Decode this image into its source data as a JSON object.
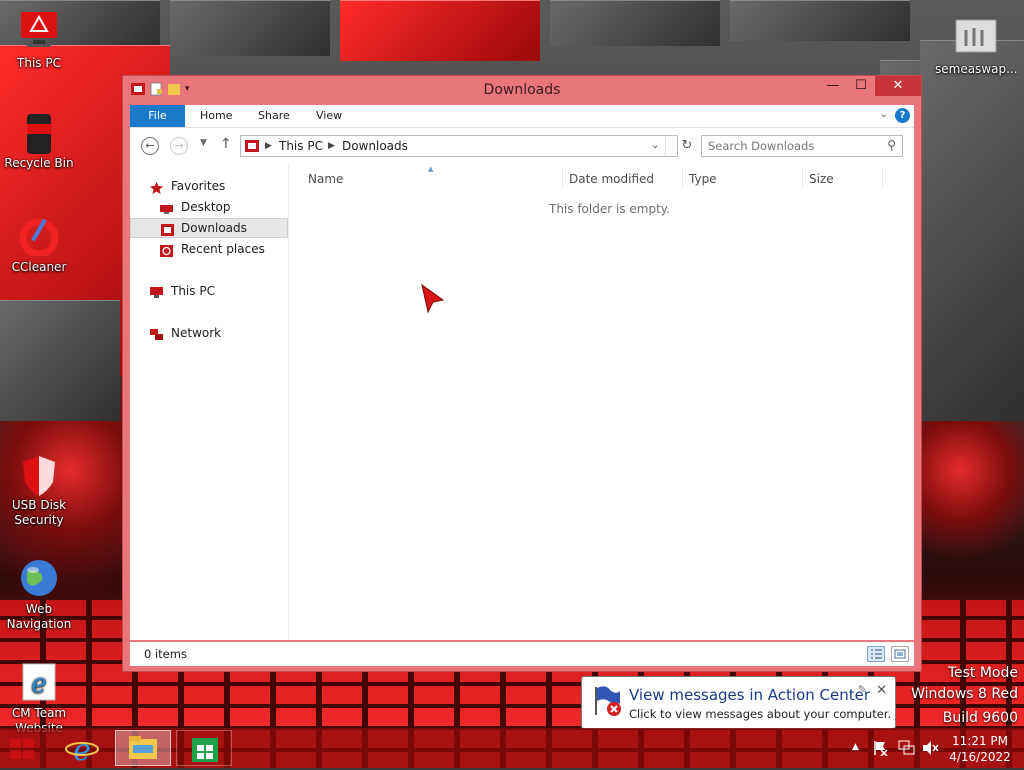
{
  "desktop": {
    "icons": [
      {
        "label": "This PC"
      },
      {
        "label": "Recycle Bin"
      },
      {
        "label": "CCleaner"
      },
      {
        "label": "USB Disk\nSecurity"
      },
      {
        "label": "Web\nNavigation"
      },
      {
        "label": "CM Team\nWebsite"
      },
      {
        "label": "semeaswap..."
      }
    ],
    "watermark": {
      "line1": "Test Mode",
      "line2": "Windows 8 Red",
      "line3": "Build 9600"
    }
  },
  "window": {
    "title": "Downloads",
    "controls": {
      "minimize": "—",
      "maximize": "☐",
      "close": "✕"
    },
    "ribbon": {
      "file": "File",
      "home": "Home",
      "share": "Share",
      "view": "View"
    },
    "address": {
      "seg1": "This PC",
      "seg2": "Downloads"
    },
    "search": {
      "placeholder": "Search Downloads"
    },
    "nav": {
      "favorites": "Favorites",
      "desktop": "Desktop",
      "downloads": "Downloads",
      "recent": "Recent places",
      "thispc": "This PC",
      "network": "Network"
    },
    "columns": {
      "name": "Name",
      "date": "Date modified",
      "type": "Type",
      "size": "Size"
    },
    "empty_text": "This folder is empty.",
    "status": {
      "count": "0 items"
    }
  },
  "notification": {
    "title": "View messages in Action Center",
    "body": "Click to view messages about your computer."
  },
  "tray": {
    "time": "11:21 PM",
    "date": "4/16/2022"
  },
  "colors": {
    "accent": "#1979ca",
    "window_frame": "#e8767a",
    "close": "#c7353b"
  }
}
